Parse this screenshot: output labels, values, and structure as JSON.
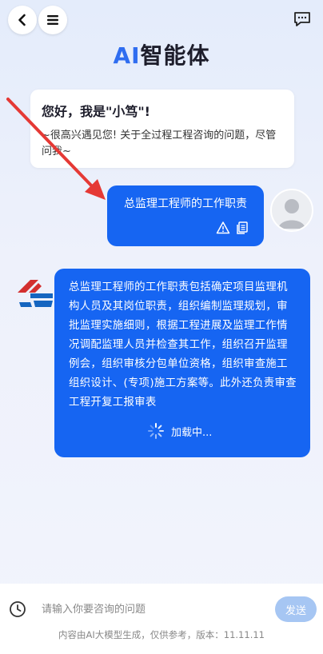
{
  "header": {
    "back_icon": "chevron-left-icon",
    "menu_icon": "hamburger-menu-icon",
    "message_icon": "chat-bubble-icon",
    "title_ai": "AI",
    "title_rest": "智能体"
  },
  "greeting": {
    "title": "您好，我是\"小笃\"!",
    "body": "~很高兴遇见您! 关于全过程工程咨询的问题，尽管问我~"
  },
  "user_message": {
    "text": "总监理工程师的工作职责",
    "tools": [
      "warning-icon",
      "copy-icon"
    ]
  },
  "bot_message": {
    "text": "总监理工程师的工作职责包括确定项目监理机构人员及其岗位职责，组织编制监理规划，审批监理实施细则，根据工程进展及监理工作情况调配监理人员并检查其工作，组织召开监理例会，组织审核分包单位资格，组织审查施工组织设计、(专项)施工方案等。此外还负责审查工程开复工报审表",
    "loading_text": "加载中..."
  },
  "composer": {
    "placeholder": "请输入你要咨询的问题",
    "send_label": "发送",
    "history_icon": "clock-icon"
  },
  "footer": {
    "disclaimer": "内容由AI大模型生成，仅供参考，版本：11.11.11"
  },
  "colors": {
    "accent": "#1665f2",
    "title_ai": "#2f6df0",
    "send_disabled": "#a6c6f3",
    "annotation_arrow": "#e53935"
  }
}
